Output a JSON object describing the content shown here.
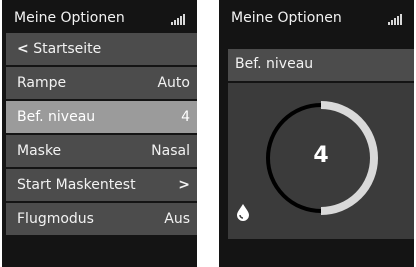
{
  "left_screen": {
    "title": "Meine Optionen",
    "menu": [
      {
        "label": "Startseite",
        "value": "",
        "icon": "chevron-left-icon"
      },
      {
        "label": "Rampe",
        "value": "Auto"
      },
      {
        "label": "Bef. niveau",
        "value": "4"
      },
      {
        "label": "Maske",
        "value": "Nasal"
      },
      {
        "label": "Start Maskentest",
        "value": "",
        "icon": "chevron-right-icon"
      },
      {
        "label": "Flugmodus",
        "value": "Aus"
      }
    ]
  },
  "right_screen": {
    "title": "Meine Optionen",
    "panel_title": "Bef. niveau",
    "gauge": {
      "value": "4",
      "level_fraction": 0.5,
      "icon": "water-drop-icon"
    }
  },
  "colors": {
    "background": "#141414",
    "item": "#4c4c4c",
    "selected_item": "#9b9b9b",
    "panel": "#3b3b3b",
    "text": "#f2f2f2"
  },
  "icons": {
    "status": "signal-strength-icon"
  }
}
